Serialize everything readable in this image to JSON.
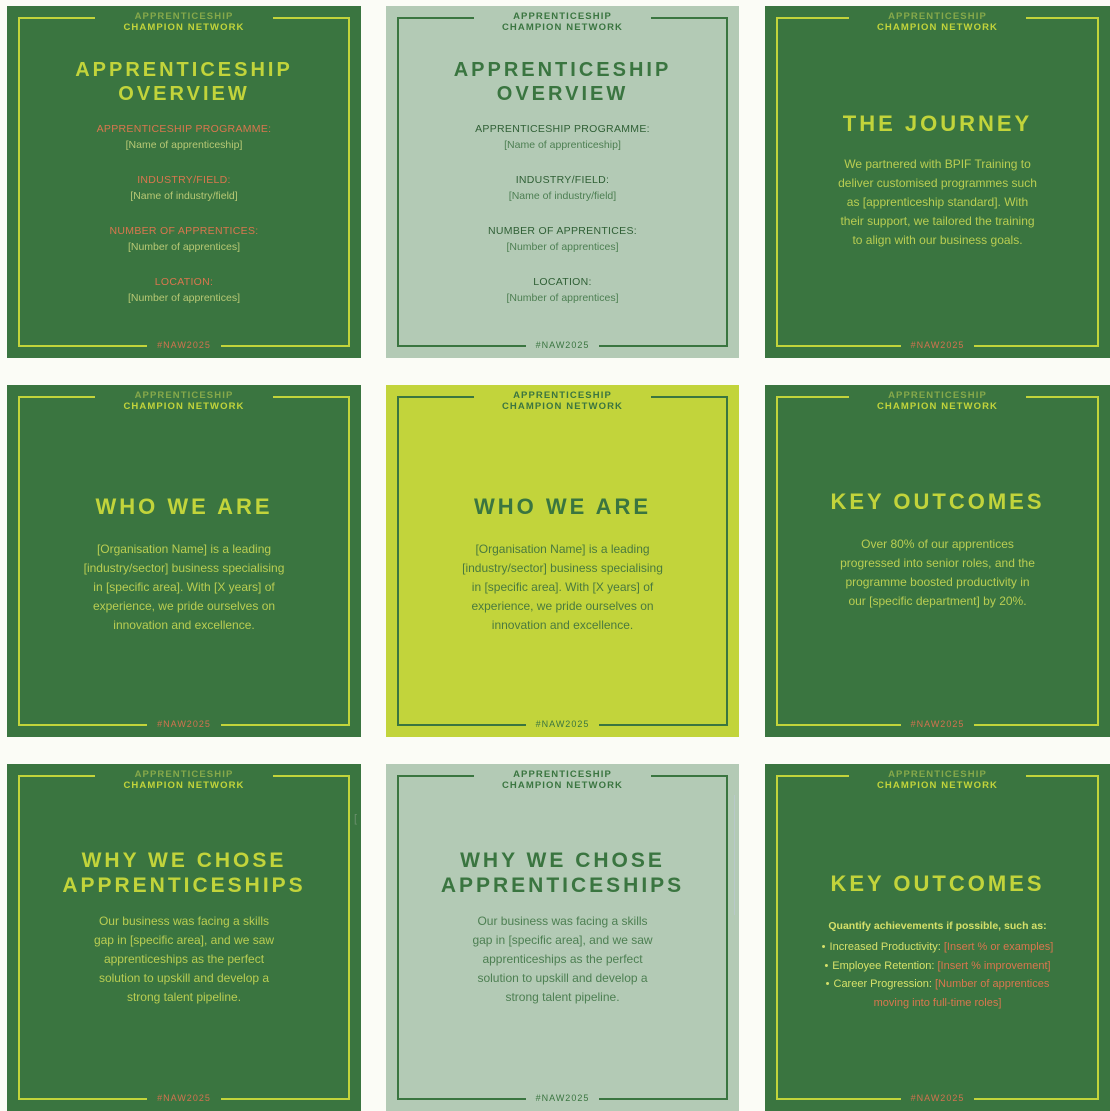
{
  "brand": {
    "line1": "APPRENTICESHIP",
    "line2": "CHAMPION NETWORK"
  },
  "hashtag": "#NAW2025",
  "colors": {
    "dark_green": "#3a7540",
    "sage": "#b3cab5",
    "lime": "#c2d43b",
    "coral": "#d9764e",
    "page_bg": "#fbfcf6"
  },
  "cards": {
    "overview": {
      "title_line1": "APPRENTICESHIP",
      "title_line2": "OVERVIEW",
      "fields": [
        {
          "label": "APPRENTICESHIP PROGRAMME:",
          "value": "[Name of apprenticeship]"
        },
        {
          "label": "INDUSTRY/FIELD:",
          "value": "[Name of industry/field]"
        },
        {
          "label": "NUMBER OF APPRENTICES:",
          "value": "[Number of apprentices]"
        },
        {
          "label": "LOCATION:",
          "value": "[Number of apprentices]"
        }
      ]
    },
    "journey": {
      "title": "THE JOURNEY",
      "lines": [
        "We partnered with BPIF Training to",
        "deliver customised programmes such",
        "as [apprenticeship standard]. With",
        "their support, we tailored the training",
        "to align with our business goals."
      ]
    },
    "who": {
      "title": "WHO WE ARE",
      "lines": [
        "[Organisation Name] is a leading",
        "[industry/sector] business specialising",
        "in [specific area]. With [X years] of",
        "experience, we pride ourselves on",
        "innovation and excellence."
      ]
    },
    "key1": {
      "title": "KEY OUTCOMES",
      "lines": [
        "Over 80% of our apprentices",
        "progressed into senior roles, and the",
        "programme boosted productivity in",
        "our [specific department] by 20%."
      ]
    },
    "why": {
      "title_line1": "WHY WE CHOSE",
      "title_line2": "APPRENTICESHIPS",
      "lines": [
        "Our business was facing a skills",
        "gap in [specific area], and we saw",
        "apprenticeships as the perfect",
        "solution to upskill and develop a",
        "strong talent pipeline."
      ]
    },
    "key2": {
      "title": "KEY OUTCOMES",
      "intro": "Quantify achievements if possible, such as:",
      "items": [
        {
          "label": "Increased Productivity: ",
          "value": "[Insert % or examples]"
        },
        {
          "label": "Employee Retention: ",
          "value": "[Insert % improvement]"
        },
        {
          "label": "Career Progression: ",
          "value": "[Number of apprentices",
          "value2": "moving into full-time roles]"
        }
      ],
      "bullet": "•"
    }
  },
  "stray_bracket": "["
}
